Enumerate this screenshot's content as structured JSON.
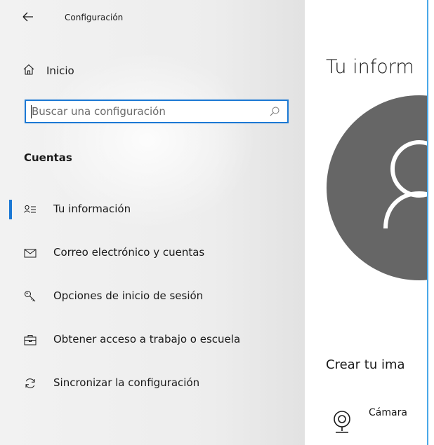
{
  "window": {
    "title": "Configuración",
    "accent_color": "#1b78d4",
    "border_color": "#4aa8e8"
  },
  "titlebar": {
    "back_icon": "back-arrow-icon"
  },
  "sidebar": {
    "home": {
      "label": "Inicio",
      "icon": "home-icon"
    },
    "search": {
      "value": "",
      "placeholder": "Buscar una configuración",
      "icon": "search-icon"
    },
    "section_heading": "Cuentas",
    "items": [
      {
        "label": "Tu información",
        "icon": "user-info-icon",
        "selected": true
      },
      {
        "label": "Correo electrónico y cuentas",
        "icon": "mail-icon",
        "selected": false
      },
      {
        "label": "Opciones de inicio de sesión",
        "icon": "key-icon",
        "selected": false
      },
      {
        "label": "Obtener acceso a trabajo o escuela",
        "icon": "briefcase-icon",
        "selected": false
      },
      {
        "label": "Sincronizar la configuración",
        "icon": "sync-icon",
        "selected": false
      }
    ]
  },
  "main": {
    "title": "Tu inform",
    "avatar": {
      "icon": "user-avatar-icon",
      "color": "#666666"
    },
    "create_heading": "Crear tu ima",
    "camera": {
      "label": "Cámara",
      "icon": "webcam-icon"
    }
  }
}
